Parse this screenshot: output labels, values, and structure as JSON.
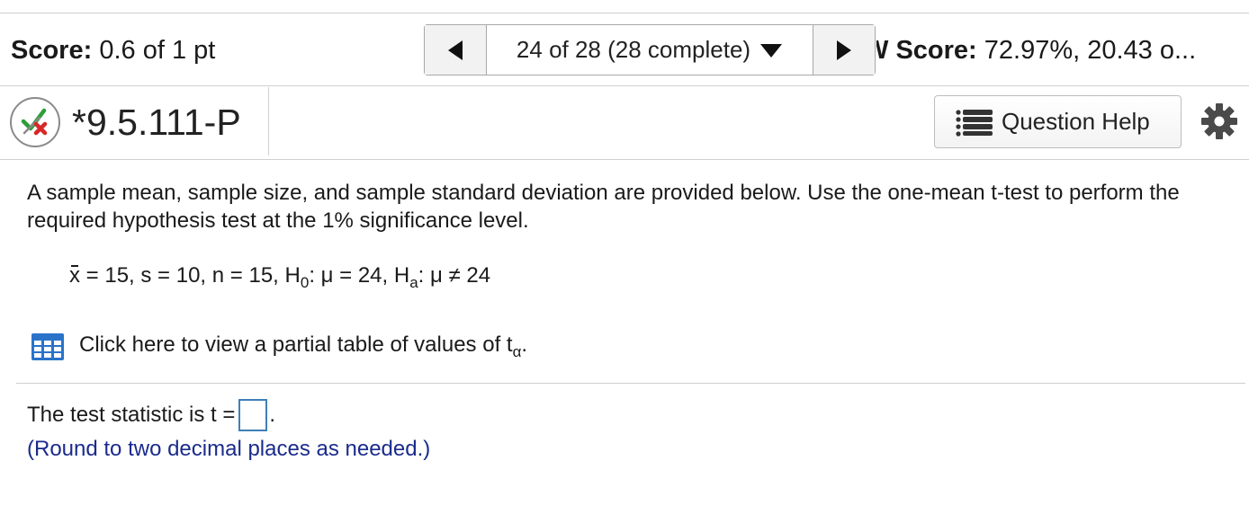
{
  "header": {
    "score_label": "Score:",
    "score_value": "0.6 of 1 pt",
    "navigation": {
      "prev_icon": "triangle-left-icon",
      "position_text": "24 of 28 (28 complete)",
      "dropdown_icon": "triangle-down-icon",
      "next_icon": "triangle-right-icon"
    },
    "hw_score_prefix": "W",
    "hw_score_label": "Score:",
    "hw_score_value": "72.97%, 20.43 o..."
  },
  "question": {
    "status_icon": "partial-credit-icon",
    "id": "*9.5.111-P",
    "help_icon": "list-icon",
    "help_label": "Question Help",
    "settings_icon": "gear-icon"
  },
  "problem": {
    "text": "A sample mean, sample size, and sample standard deviation are provided below. Use the one-mean t-test to perform the required hypothesis test at the 1% significance level.",
    "given": {
      "xbar_symbol": "x",
      "xbar_rest": "= 15, s = 10, n = 15, H",
      "h0_sub": "0",
      "h0_rest": ": μ = 24, H",
      "ha_sub": "a",
      "ha_rest": ": μ ≠ 24"
    },
    "table_link": {
      "icon": "table-icon",
      "text": "Click here to view a partial table of values of t",
      "sub": "α",
      "suffix": "."
    }
  },
  "answer": {
    "prompt": "The test statistic is t =",
    "value": "",
    "suffix": ".",
    "hint": "(Round to two decimal places as needed.)"
  },
  "colors": {
    "accent_blue": "#3f7fb8",
    "hint_text": "#1a2b8c",
    "check_green": "#2e9e3a",
    "cross_red": "#d62828",
    "table_icon_blue": "#2a73c9"
  }
}
